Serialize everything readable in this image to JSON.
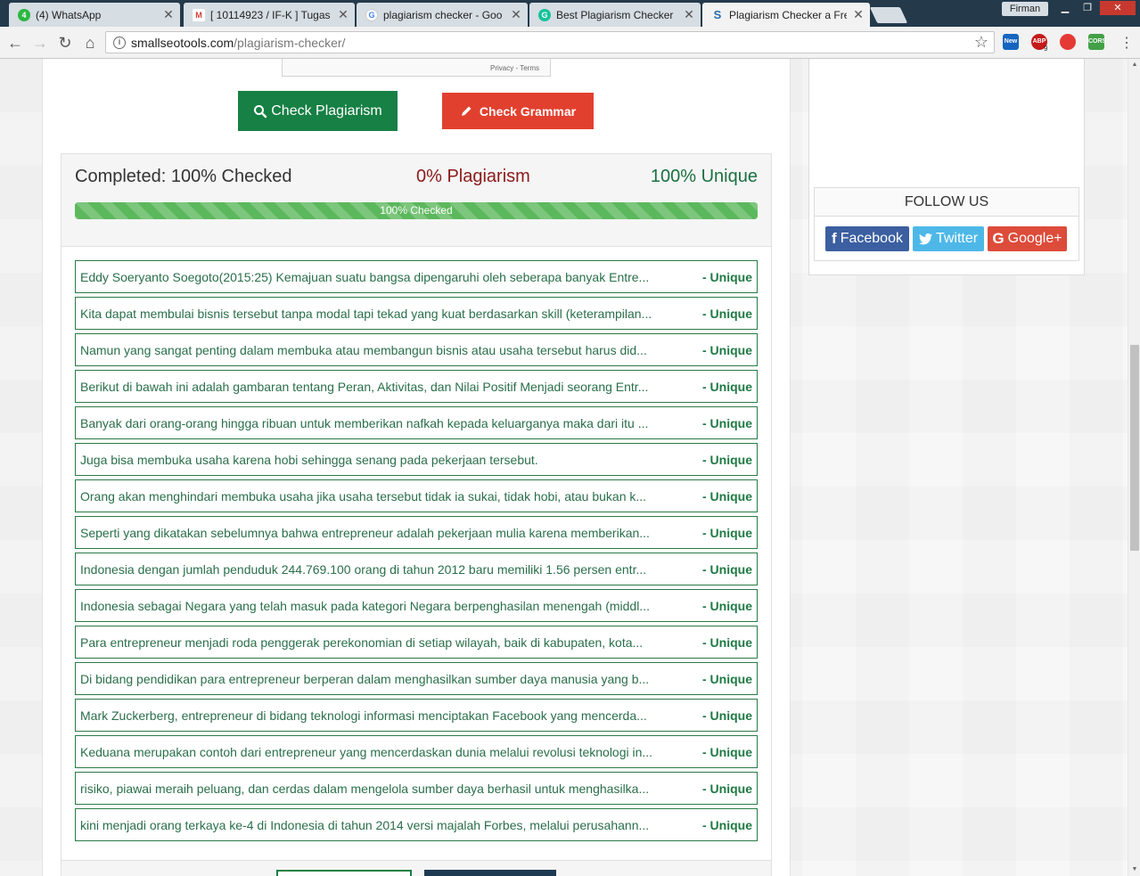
{
  "browser": {
    "tabs": [
      {
        "title": "(4) WhatsApp",
        "favicon": "whatsapp-icon"
      },
      {
        "title": "[ 10114923 / IF-K ] Tugas",
        "favicon": "gmail-icon"
      },
      {
        "title": "plagiarism checker - Goo",
        "favicon": "google-icon"
      },
      {
        "title": "Best Plagiarism Checker",
        "favicon": "grammarly-icon"
      },
      {
        "title": "Plagiarism Checker a Free",
        "favicon": "smallseotools-icon"
      }
    ],
    "user": "Firman",
    "url_host": "smallseotools.com",
    "url_path": "/plagiarism-checker/",
    "extensions": [
      {
        "label": "New",
        "color": "#1565c0"
      },
      {
        "label": "ABP",
        "badge": "9",
        "color": "#c41a1a"
      },
      {
        "label": "",
        "color": "#e53935"
      },
      {
        "label": "CORS",
        "color": "#43a047"
      }
    ]
  },
  "captcha": {
    "text": "Privacy - Terms"
  },
  "buttons": {
    "check_plagiarism": "Check Plagiarism",
    "check_grammar": "Check Grammar"
  },
  "summary": {
    "completed": "Completed: 100% Checked",
    "plagiarism": "0% Plagiarism",
    "unique": "100% Unique",
    "progress_label": "100% Checked",
    "progress_value": 1.0
  },
  "sentences": [
    {
      "text": "Eddy Soeryanto Soegoto(2015:25) Kemajuan suatu bangsa dipengaruhi oleh seberapa banyak Entre...",
      "status": "- Unique"
    },
    {
      "text": "Kita dapat membulai bisnis tersebut tanpa modal tapi tekad yang kuat berdasarkan skill (keterampilan...",
      "status": "- Unique"
    },
    {
      "text": "Namun yang sangat penting dalam membuka atau membangun bisnis atau usaha tersebut harus did...",
      "status": "- Unique"
    },
    {
      "text": "Berikut di bawah ini adalah gambaran tentang Peran, Aktivitas, dan Nilai Positif Menjadi seorang Entr...",
      "status": "- Unique"
    },
    {
      "text": "Banyak dari orang-orang hingga ribuan untuk memberikan nafkah kepada keluarganya maka dari itu ...",
      "status": "- Unique"
    },
    {
      "text": "Juga bisa membuka usaha karena hobi sehingga senang pada pekerjaan tersebut.",
      "status": "- Unique"
    },
    {
      "text": "Orang akan menghindari membuka usaha jika usaha tersebut tidak ia sukai, tidak hobi, atau bukan k...",
      "status": "- Unique"
    },
    {
      "text": "Seperti yang dikatakan sebelumnya bahwa entrepreneur adalah pekerjaan mulia karena memberikan...",
      "status": "- Unique"
    },
    {
      "text": "Indonesia dengan jumlah penduduk 244.769.100 orang di tahun 2012 baru memiliki 1.56 persen entr...",
      "status": "- Unique"
    },
    {
      "text": "Indonesia sebagai Negara yang telah masuk pada kategori Negara berpenghasilan menengah (middl...",
      "status": "- Unique"
    },
    {
      "text": "Para entrepreneur menjadi roda penggerak perekonomian di setiap wilayah, baik di kabupaten, kota...",
      "status": "- Unique"
    },
    {
      "text": "Di bidang pendidikan para entrepreneur berperan dalam menghasilkan sumber daya manusia yang b...",
      "status": "- Unique"
    },
    {
      "text": "Mark Zuckerberg, entrepreneur di bidang teknologi informasi menciptakan Facebook yang mencerda...",
      "status": "- Unique"
    },
    {
      "text": "Keduana merupakan contoh dari entrepreneur yang mencerdaskan dunia melalui revolusi teknologi in...",
      "status": "- Unique"
    },
    {
      "text": "risiko, piawai meraih peluang, dan cerdas dalam mengelola sumber daya berhasil untuk menghasilka...",
      "status": "- Unique"
    },
    {
      "text": "kini menjadi orang terkaya ke-4 di Indonesia di tahun 2014 versi majalah Forbes, melalui perusahann...",
      "status": "- Unique"
    }
  ],
  "sidebar": {
    "follow_title": "FOLLOW US",
    "facebook": "Facebook",
    "twitter": "Twitter",
    "googleplus": "Google+"
  },
  "colors": {
    "check_plagiarism_bg": "#178044",
    "check_grammar_bg": "#e2402f",
    "unique_green": "#1a7040",
    "plagiarism_red": "#8b1a1a"
  }
}
